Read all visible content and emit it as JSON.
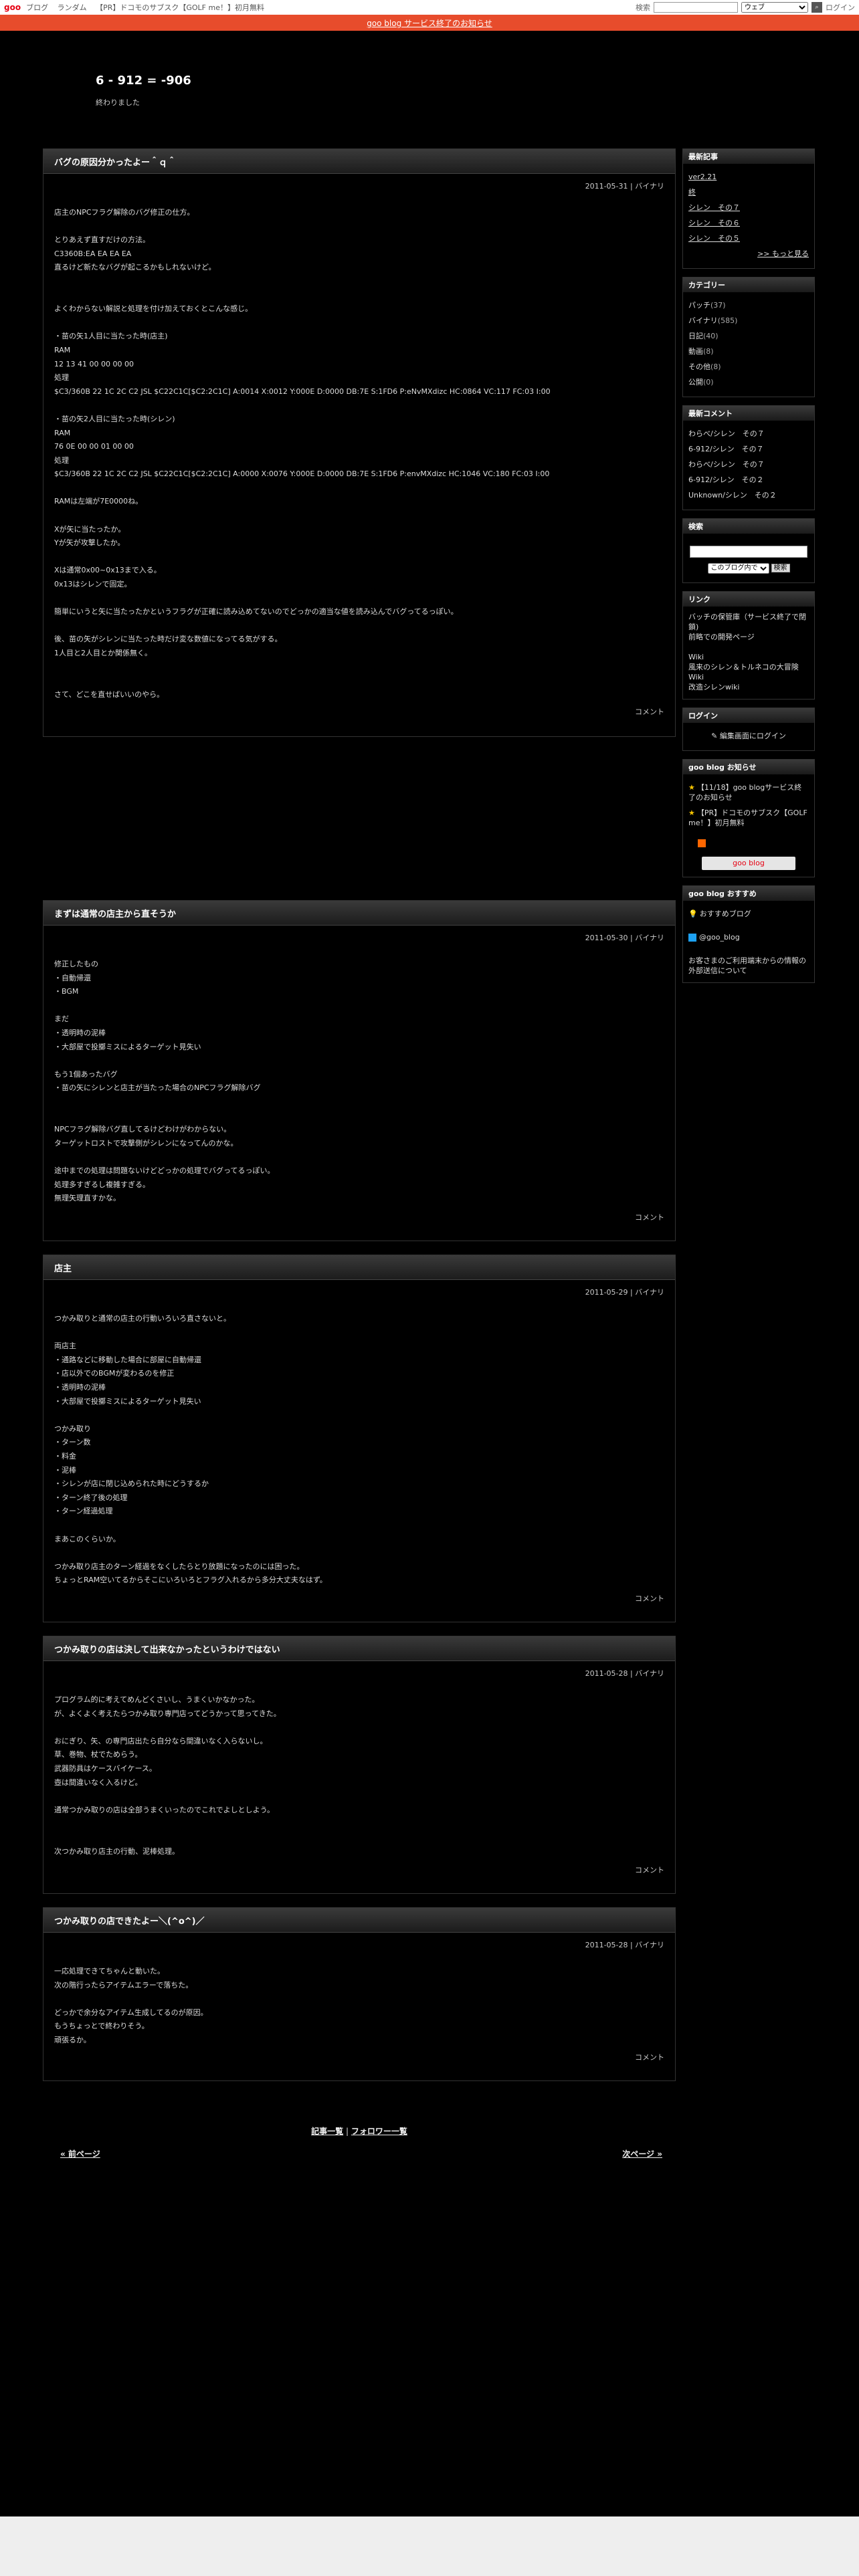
{
  "topbar": {
    "logo": "goo",
    "links": [
      "ブログ",
      "ランダム",
      "【PR】ドコモのサブスク【GOLF me！】初月無料"
    ],
    "search_type": "ウェブ",
    "login": "ログイン"
  },
  "notice": "goo blog サービス終了のお知らせ",
  "blog": {
    "title": "6 - 912 = -906",
    "desc": "終わりました"
  },
  "articles": [
    {
      "title": "バグの原因分かったよー＾ｑ＾",
      "meta": "2011-05-31 | バイナリ",
      "body": "店主のNPCフラグ解除のバグ修正の仕方。\n\nとりあえず直すだけの方法。\nC3360B:EA EA EA EA\n直るけど新たなバグが起こるかもしれないけど。\n\n\nよくわからない解説と処理を付け加えておくとこんな感じ。\n\n・苗の矢1人目に当たった時(店主)\nRAM\n12 13 41 00 00 00 00\n処理\n$C3/360B 22 1C 2C C2 JSL $C22C1C[$C2:2C1C] A:0014 X:0012 Y:000E D:0000 DB:7E S:1FD6 P:eNvMXdizc HC:0864 VC:117 FC:03 I:00\n\n・苗の矢2人目に当たった時(シレン)\nRAM\n76 0E 00 00 01 00 00\n処理\n$C3/360B 22 1C 2C C2 JSL $C22C1C[$C2:2C1C] A:0000 X:0076 Y:000E D:0000 DB:7E S:1FD6 P:envMXdizc HC:1046 VC:180 FC:03 I:00\n\nRAMは左端が7E0000ね。\n\nXが矢に当たったか。\nYが矢が攻撃したか。\n\nXは通常0x00~0x13まで入る。\n0x13はシレンで固定。\n\n簡単にいうと矢に当たったかというフラグが正確に読み込めてないのでどっかの適当な値を読み込んでバグってるっぽい。\n\n後、苗の矢がシレンに当たった時だけ変な数値になってる気がする。\n1人目と2人目とか関係無く。\n\n\nさて、どこを直せばいいのやら。",
      "footer": "コメント"
    },
    {
      "title": "まずは通常の店主から直そうか",
      "meta": "2011-05-30 | バイナリ",
      "body": "修正したもの\n・自動帰還\n・BGM\n\nまだ\n・透明時の泥棒\n・大部屋で投擲ミスによるターゲット見失い\n\nもう1個あったバグ\n・苗の矢にシレンと店主が当たった場合のNPCフラグ解除バグ\n\n\nNPCフラグ解除バグ直してるけどわけがわからない。\nターゲットロストで攻撃側がシレンになってんのかな。\n\n途中までの処理は問題ないけどどっかの処理でバグってるっぽい。\n処理多すぎるし複雑すぎる。\n無理矢理直すかな。",
      "footer": "コメント"
    },
    {
      "title": "店主",
      "meta": "2011-05-29 | バイナリ",
      "body": "つかみ取りと通常の店主の行動いろいろ直さないと。\n\n両店主\n・通路などに移動した場合に部屋に自動帰還\n・店以外でのBGMが変わるのを修正\n・透明時の泥棒\n・大部屋で投擲ミスによるターゲット見失い\n\nつかみ取り\n・ターン数\n・料金\n・泥棒\n・シレンが店に閉じ込められた時にどうするか\n・ターン終了後の処理\n・ターン経過処理\n\nまあこのくらいか。\n\nつかみ取り店主のターン経過をなくしたらとり放題になったのには困った。\nちょっとRAM空いてるからそこにいろいろとフラグ入れるから多分大丈夫なはず。",
      "footer": "コメント"
    },
    {
      "title": "つかみ取りの店は決して出来なかったというわけではない",
      "meta": "2011-05-28 | バイナリ",
      "body": "プログラム的に考えてめんどくさいし、うまくいかなかった。\nが、よくよく考えたらつかみ取り専門店ってどうかって思ってきた。\n\nおにぎり、矢、の専門店出たら自分なら間違いなく入らないし。\n草、巻物、杖でためらう。\n武器防具はケースバイケース。\n壺は間違いなく入るけど。\n\n通常つかみ取りの店は全部うまくいったのでこれでよしとしよう。\n\n\n次つかみ取り店主の行動、泥棒処理。",
      "footer": "コメント"
    },
    {
      "title": "つかみ取りの店できたよー＼(^o^)／",
      "meta": "2011-05-28 | バイナリ",
      "body": "一応処理できてちゃんと動いた。\n次の階行ったらアイテムエラーで落ちた。\n\nどっかで余分なアイテム生成してるのが原因。\nもうちょっとで終わりそう。\n頑張るか。",
      "footer": "コメント"
    }
  ],
  "bottomnav": {
    "list": "記事一覧",
    "sep": " | ",
    "follow": "フォロワー一覧"
  },
  "pager": {
    "prev": "« 前ページ",
    "next": "次ページ »"
  },
  "sidebar": {
    "recent": {
      "title": "最新記事",
      "items": [
        "ver2.21",
        "終",
        "シレン　その７",
        "シレン　その６",
        "シレン　その５"
      ],
      "more": ">> もっと見る"
    },
    "categories": {
      "title": "カテゴリー",
      "items": [
        {
          "name": "パッチ",
          "count": "(37)"
        },
        {
          "name": "バイナリ",
          "count": "(585)"
        },
        {
          "name": "日記",
          "count": "(40)"
        },
        {
          "name": "動画",
          "count": "(8)"
        },
        {
          "name": "その他",
          "count": "(8)"
        },
        {
          "name": "公開",
          "count": "(0)"
        }
      ]
    },
    "comments": {
      "title": "最新コメント",
      "items": [
        {
          "who": "わらべ/",
          "what": "シレン　その７"
        },
        {
          "who": "6-912/",
          "what": "シレン　その７"
        },
        {
          "who": "わらべ/",
          "what": "シレン　その７"
        },
        {
          "who": "6-912/",
          "what": "シレン　その２"
        },
        {
          "who": "Unknown/",
          "what": "シレン　その２"
        }
      ]
    },
    "search": {
      "title": "検索",
      "scope": "このブログ内で",
      "button": "検索"
    },
    "links": {
      "title": "リンク",
      "lines": [
        {
          "text": "バッチの保管庫（サービス終了で閉鎖)",
          "link": false
        },
        {
          "text": "前略での開発ページ",
          "link": true
        },
        {
          "text": "",
          "link": false
        },
        {
          "text": "Wiki",
          "link": false
        },
        {
          "text": "風来のシレン＆トルネコの大冒険 Wiki",
          "link": true
        },
        {
          "text": "改造シレンwiki",
          "link": true
        }
      ]
    },
    "login": {
      "title": "ログイン",
      "text": "編集画面にログイン"
    },
    "goonews": {
      "title": "goo blog お知らせ",
      "items": [
        "【11/18】goo blogサービス終了のお知らせ",
        "【PR】ドコモのサブスク【GOLF me！】初月無料"
      ],
      "button": "goo blog"
    },
    "recommend": {
      "title": "goo blog おすすめ",
      "item": "おすすめブログ",
      "twitter": "@goo_blog",
      "info": "お客さまのご利用端末からの情報の外部送信について"
    }
  }
}
